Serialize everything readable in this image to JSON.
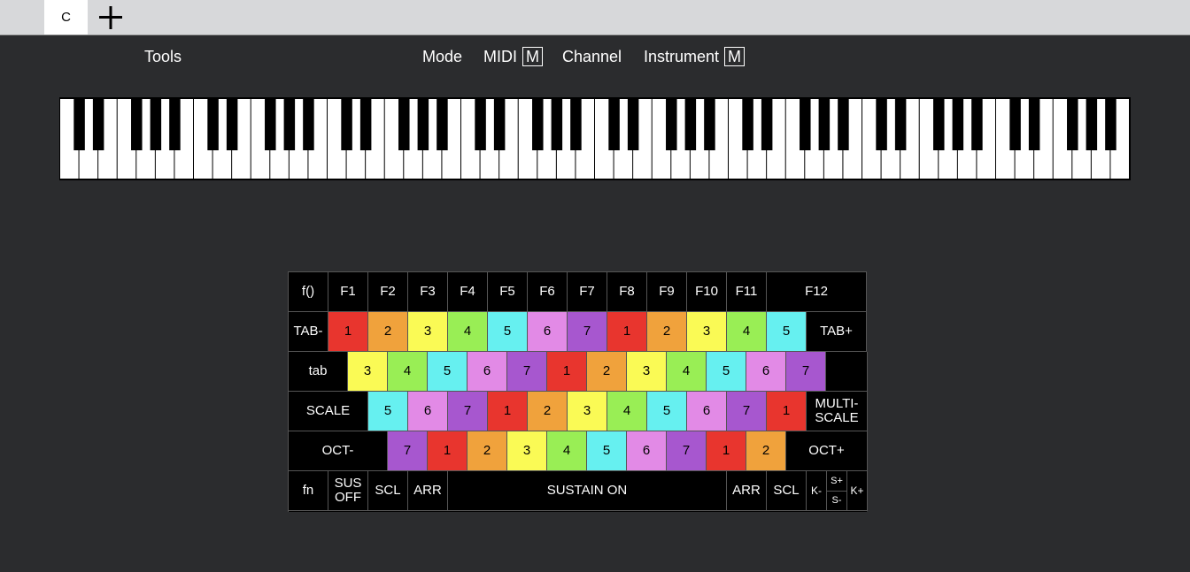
{
  "tabs": {
    "active_label": "C"
  },
  "menu": {
    "tools": "Tools",
    "mode": "Mode",
    "midi": "MIDI",
    "midi_badge": "M",
    "channel": "Channel",
    "instrument": "Instrument",
    "instrument_badge": "M"
  },
  "piano": {
    "white_keys": 56,
    "octaves": 8
  },
  "colors": {
    "1": "#e8352e",
    "2": "#f0a23c",
    "3": "#fafa55",
    "4": "#99ee55",
    "5": "#66f0f0",
    "6": "#e28ae6",
    "7": "#a757cf"
  },
  "keyboard": {
    "rows": [
      [
        {
          "label": "f()",
          "w": 45
        },
        {
          "label": "F1",
          "w": 45
        },
        {
          "label": "F2",
          "w": 45
        },
        {
          "label": "F3",
          "w": 45
        },
        {
          "label": "F4",
          "w": 45
        },
        {
          "label": "F5",
          "w": 45
        },
        {
          "label": "F6",
          "w": 45
        },
        {
          "label": "F7",
          "w": 45
        },
        {
          "label": "F8",
          "w": 45
        },
        {
          "label": "F9",
          "w": 45
        },
        {
          "label": "F10",
          "w": 45
        },
        {
          "label": "F11",
          "w": 45
        },
        {
          "label": "F12",
          "w": 113
        }
      ],
      [
        {
          "label": "TAB-",
          "w": 45
        },
        {
          "label": "1",
          "note": 1,
          "w": 45
        },
        {
          "label": "2",
          "note": 2,
          "w": 45
        },
        {
          "label": "3",
          "note": 3,
          "w": 45
        },
        {
          "label": "4",
          "note": 4,
          "w": 45
        },
        {
          "label": "5",
          "note": 5,
          "w": 45
        },
        {
          "label": "6",
          "note": 6,
          "w": 45
        },
        {
          "label": "7",
          "note": 7,
          "w": 45
        },
        {
          "label": "1",
          "note": 1,
          "w": 45
        },
        {
          "label": "2",
          "note": 2,
          "w": 45
        },
        {
          "label": "3",
          "note": 3,
          "w": 45
        },
        {
          "label": "4",
          "note": 4,
          "w": 45
        },
        {
          "label": "5",
          "note": 5,
          "w": 45
        },
        {
          "label": "TAB+",
          "w": 68
        }
      ],
      [
        {
          "label": "tab",
          "w": 67
        },
        {
          "label": "3",
          "note": 3,
          "w": 45
        },
        {
          "label": "4",
          "note": 4,
          "w": 45
        },
        {
          "label": "5",
          "note": 5,
          "w": 45
        },
        {
          "label": "6",
          "note": 6,
          "w": 45
        },
        {
          "label": "7",
          "note": 7,
          "w": 45
        },
        {
          "label": "1",
          "note": 1,
          "w": 45
        },
        {
          "label": "2",
          "note": 2,
          "w": 45
        },
        {
          "label": "3",
          "note": 3,
          "w": 45
        },
        {
          "label": "4",
          "note": 4,
          "w": 45
        },
        {
          "label": "5",
          "note": 5,
          "w": 45
        },
        {
          "label": "6",
          "note": 6,
          "w": 45
        },
        {
          "label": "7",
          "note": 7,
          "w": 45
        },
        {
          "label": "",
          "w": 47
        }
      ],
      [
        {
          "label": "SCALE",
          "w": 90
        },
        {
          "label": "5",
          "note": 5,
          "w": 45
        },
        {
          "label": "6",
          "note": 6,
          "w": 45
        },
        {
          "label": "7",
          "note": 7,
          "w": 45
        },
        {
          "label": "1",
          "note": 1,
          "w": 45
        },
        {
          "label": "2",
          "note": 2,
          "w": 45
        },
        {
          "label": "3",
          "note": 3,
          "w": 45
        },
        {
          "label": "4",
          "note": 4,
          "w": 45
        },
        {
          "label": "5",
          "note": 5,
          "w": 45
        },
        {
          "label": "6",
          "note": 6,
          "w": 45
        },
        {
          "label": "7",
          "note": 7,
          "w": 45
        },
        {
          "label": "1",
          "note": 1,
          "w": 45
        },
        {
          "label": "MULTI-\nSCALE",
          "w": 69
        }
      ],
      [
        {
          "label": "OCT-",
          "w": 112
        },
        {
          "label": "7",
          "note": 7,
          "w": 45
        },
        {
          "label": "1",
          "note": 1,
          "w": 45
        },
        {
          "label": "2",
          "note": 2,
          "w": 45
        },
        {
          "label": "3",
          "note": 3,
          "w": 45
        },
        {
          "label": "4",
          "note": 4,
          "w": 45
        },
        {
          "label": "5",
          "note": 5,
          "w": 45
        },
        {
          "label": "6",
          "note": 6,
          "w": 45
        },
        {
          "label": "7",
          "note": 7,
          "w": 45
        },
        {
          "label": "1",
          "note": 1,
          "w": 45
        },
        {
          "label": "2",
          "note": 2,
          "w": 45
        },
        {
          "label": "OCT+",
          "w": 92
        }
      ],
      [
        {
          "label": "fn",
          "w": 45
        },
        {
          "label": "SUS\nOFF",
          "w": 45
        },
        {
          "label": "SCL",
          "w": 45
        },
        {
          "label": "ARR",
          "w": 45
        },
        {
          "label": "SUSTAIN ON",
          "w": 315
        },
        {
          "label": "ARR",
          "w": 45
        },
        {
          "label": "SCL",
          "w": 45
        },
        {
          "label": "K-",
          "w": 23,
          "small": true
        },
        {
          "split": [
            "S+",
            "S-"
          ],
          "w": 23
        },
        {
          "label": "K+",
          "w": 23,
          "small": true
        }
      ]
    ]
  }
}
